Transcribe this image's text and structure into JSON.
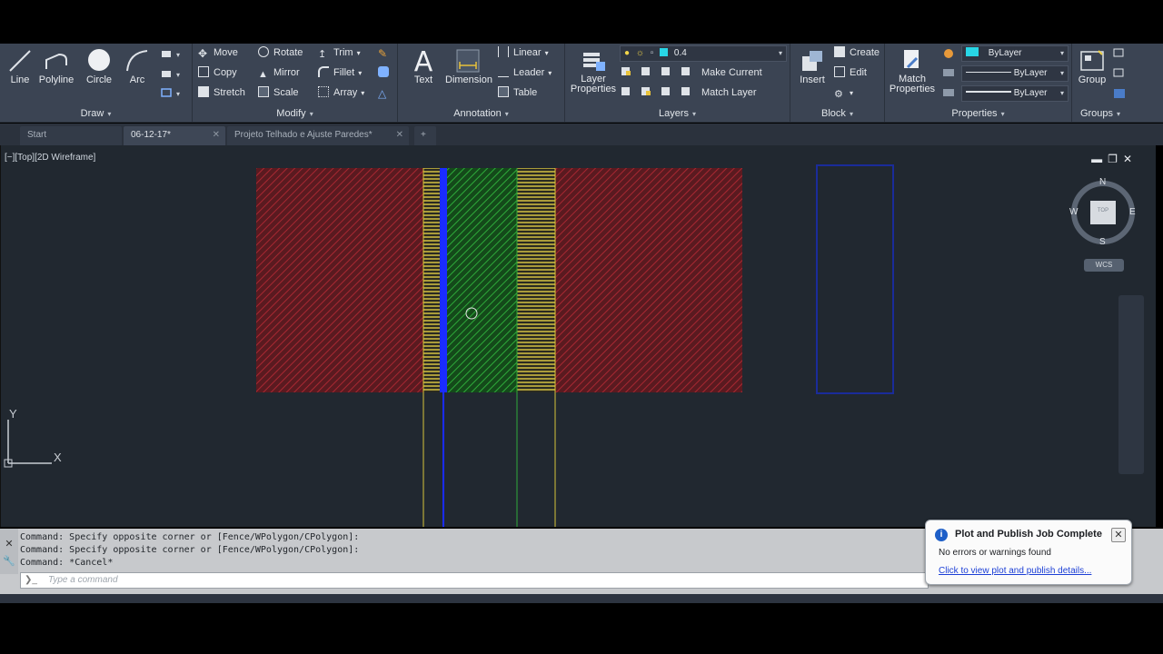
{
  "ribbon": {
    "draw": {
      "title": "Draw",
      "line": "Line",
      "polyline": "Polyline",
      "circle": "Circle",
      "arc": "Arc"
    },
    "modify": {
      "title": "Modify",
      "move": "Move",
      "rotate": "Rotate",
      "trim": "Trim",
      "copy": "Copy",
      "mirror": "Mirror",
      "fillet": "Fillet",
      "stretch": "Stretch",
      "scale": "Scale",
      "array": "Array"
    },
    "annotation": {
      "title": "Annotation",
      "text": "Text",
      "dimension": "Dimension",
      "linear": "Linear",
      "leader": "Leader",
      "table": "Table"
    },
    "layers": {
      "title": "Layers",
      "layer_properties": "Layer Properties",
      "layer_value": "0.4",
      "make_current": "Make Current",
      "match_layer": "Match Layer"
    },
    "block": {
      "title": "Block",
      "insert": "Insert",
      "create": "Create",
      "edit": "Edit"
    },
    "properties": {
      "title": "Properties",
      "match_properties": "Match Properties",
      "color": "ByLayer",
      "linetype": "ByLayer",
      "lineweight": "ByLayer"
    },
    "groups": {
      "title": "Groups",
      "group": "Group"
    }
  },
  "tabs": [
    {
      "label": "Start"
    },
    {
      "label": "06-12-17*"
    },
    {
      "label": "Projeto Telhado e Ajuste Paredes*"
    }
  ],
  "viewport": {
    "label": "[−][Top][2D Wireframe]",
    "compass": {
      "n": "N",
      "s": "S",
      "e": "E",
      "w": "W",
      "cube": "TOP"
    },
    "wcs": "WCS",
    "axis_x": "X",
    "axis_y": "Y"
  },
  "command": {
    "lines": [
      "Command: Specify opposite corner or [Fence/WPolygon/CPolygon]:",
      "Command: Specify opposite corner or [Fence/WPolygon/CPolygon]:",
      "Command: *Cancel*"
    ],
    "placeholder": "Type a command"
  },
  "notification": {
    "title": "Plot and Publish Job Complete",
    "message": "No errors or warnings found",
    "link": "Click to view plot and publish details..."
  },
  "colors": {
    "hatch_red": "#7a1f24",
    "hatch_green": "#1f7a2a",
    "yellow": "#d6c43a",
    "blue": "#1a2cff",
    "bylayer_swatch": "#28d6e6"
  }
}
